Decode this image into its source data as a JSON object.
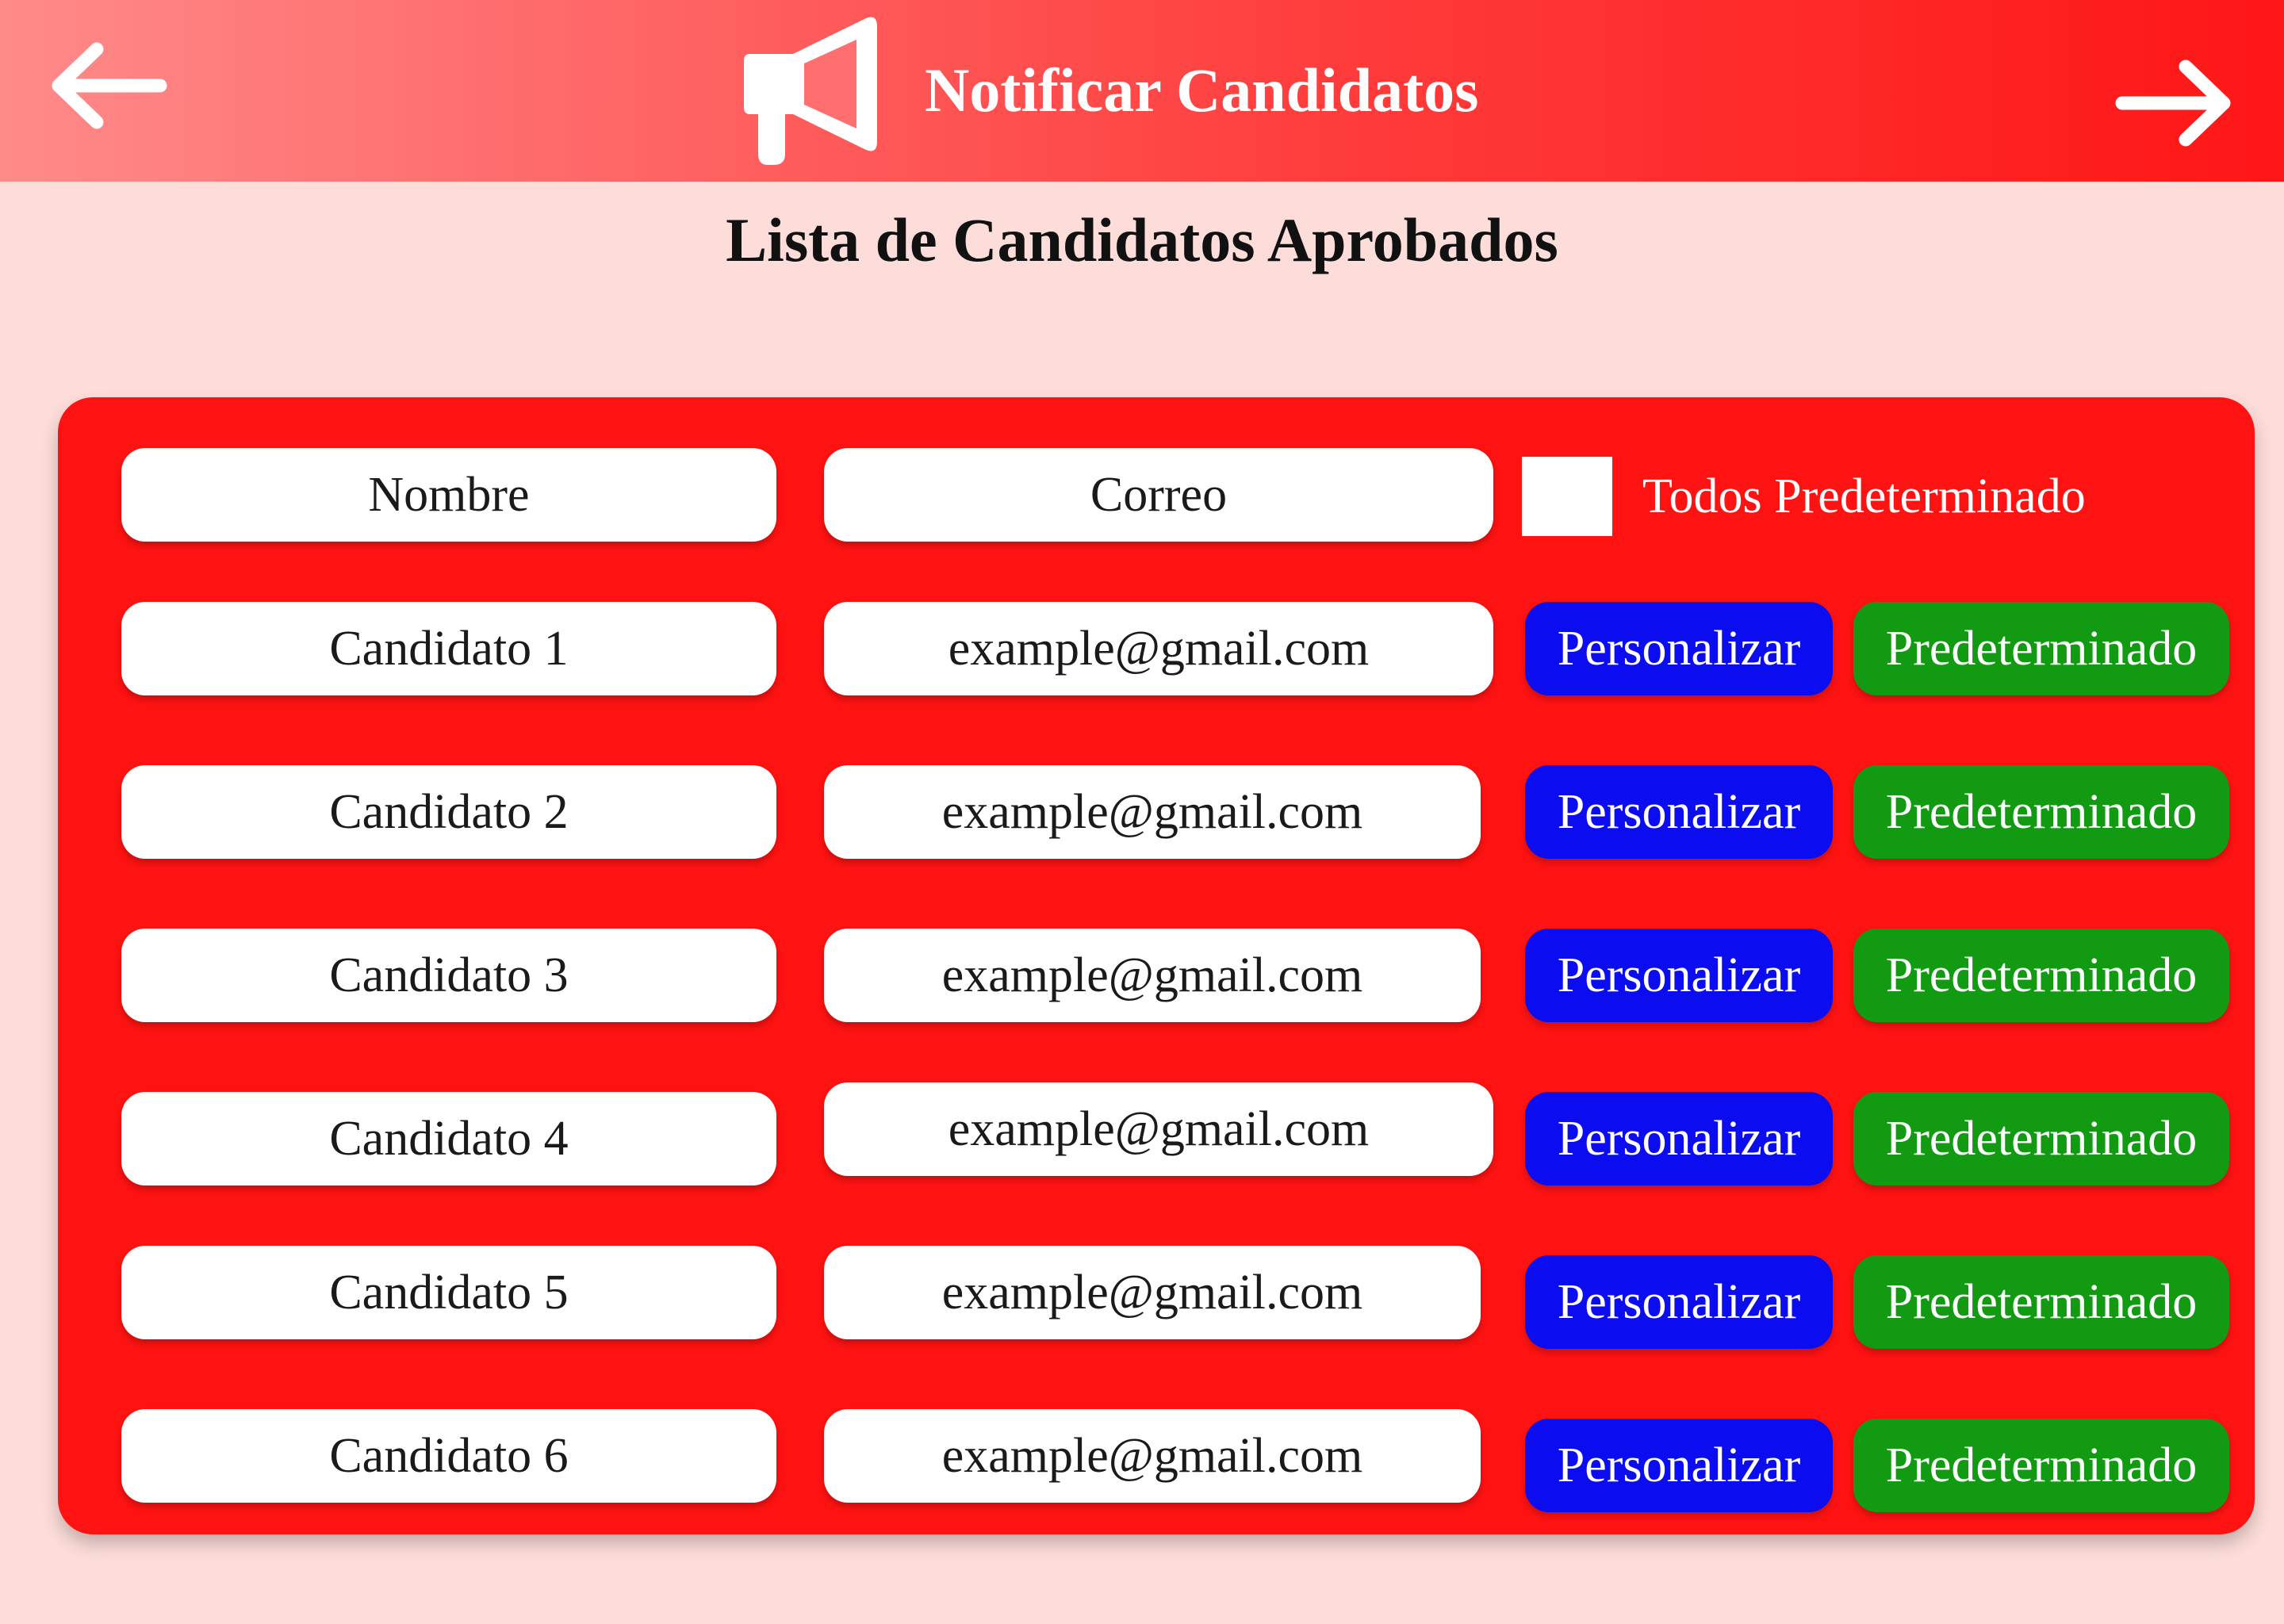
{
  "header": {
    "title": "Notificar Candidatos",
    "back_icon": "arrow-left-icon",
    "forward_icon": "arrow-right-icon",
    "title_icon": "megaphone-icon"
  },
  "page": {
    "title": "Lista de Candidatos Aprobados"
  },
  "table": {
    "headers": {
      "name": "Nombre",
      "email": "Correo",
      "all_default_label": "Todos Predeterminado"
    },
    "all_default_checked": false,
    "rows": [
      {
        "name": "Candidato 1",
        "email": "example@gmail.com",
        "custom_label": "Personalizar",
        "default_label": "Predeterminado"
      },
      {
        "name": "Candidato 2",
        "email": "example@gmail.com",
        "custom_label": "Personalizar",
        "default_label": "Predeterminado"
      },
      {
        "name": "Candidato 3",
        "email": "example@gmail.com",
        "custom_label": "Personalizar",
        "default_label": "Predeterminado"
      },
      {
        "name": "Candidato 4",
        "email": "example@gmail.com",
        "custom_label": "Personalizar",
        "default_label": "Predeterminado"
      },
      {
        "name": "Candidato 5",
        "email": "example@gmail.com",
        "custom_label": "Personalizar",
        "default_label": "Predeterminado"
      },
      {
        "name": "Candidato 6",
        "email": "example@gmail.com",
        "custom_label": "Personalizar",
        "default_label": "Predeterminado"
      }
    ]
  },
  "colors": {
    "background": "#fdddda",
    "panel": "#ff1212",
    "header_gradient_start": "#ff8a8a",
    "header_gradient_end": "#ff1616",
    "custom_button": "#0b0df0",
    "default_button": "#129a12"
  }
}
